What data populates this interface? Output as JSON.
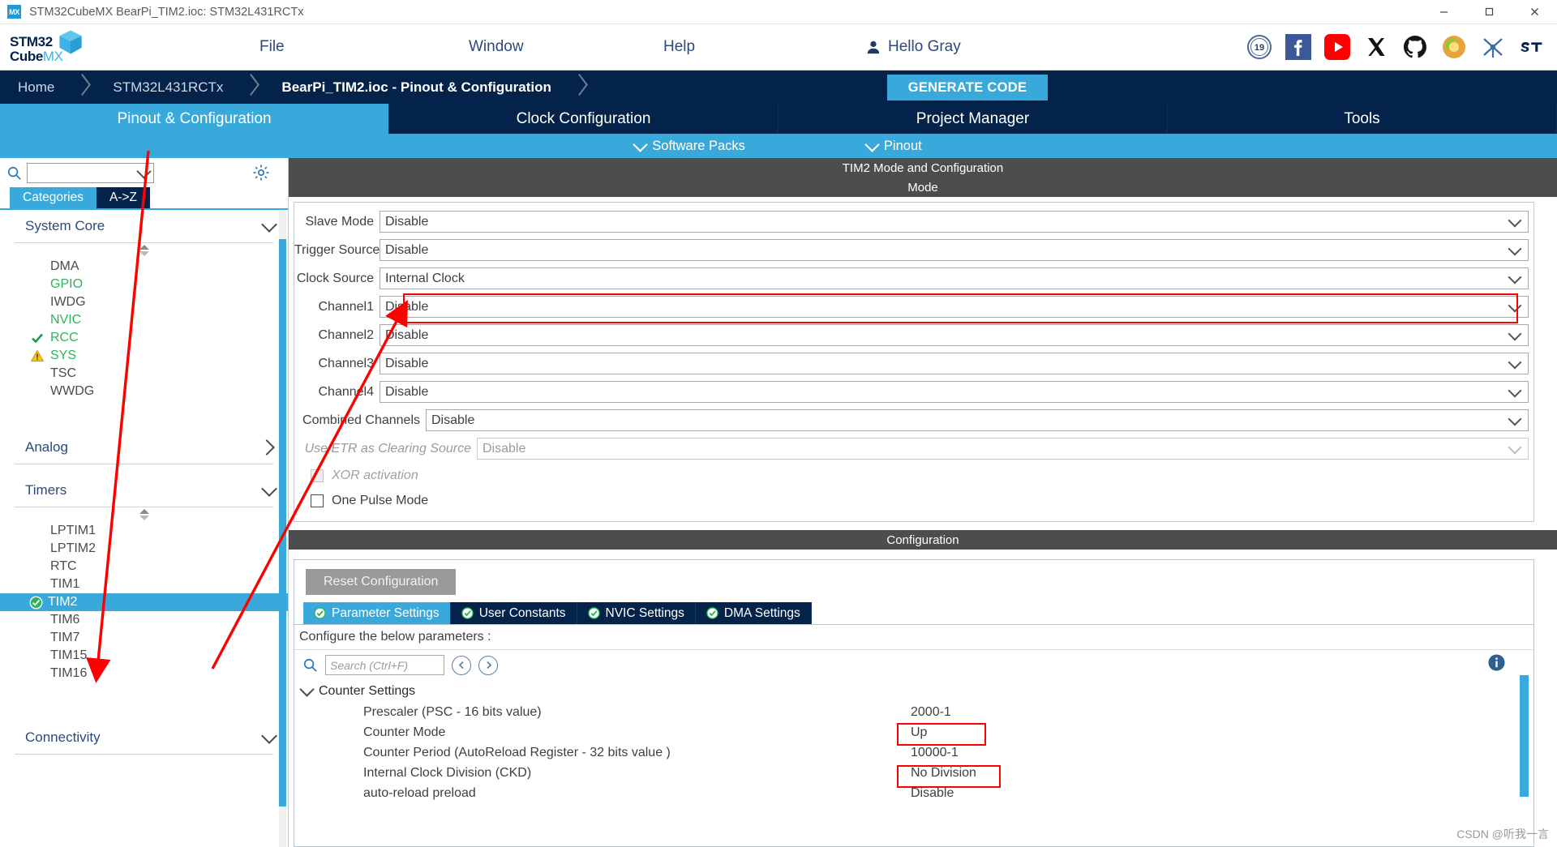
{
  "window": {
    "title": "STM32CubeMX BearPi_TIM2.ioc: STM32L431RCTx",
    "app_icon": "cubemx-icon",
    "minimize": "–",
    "maximize": "❐",
    "close": "✕"
  },
  "brand": {
    "line1_bold": "STM32",
    "line1_thin": "",
    "line2_bold": "Cube",
    "line2_thin": "MX"
  },
  "menu": {
    "file": "File",
    "window": "Window",
    "help": "Help",
    "user": "Hello Gray"
  },
  "socials": [
    {
      "name": "anniversary-badge-icon",
      "label": "19"
    },
    {
      "name": "facebook-icon",
      "label": "f"
    },
    {
      "name": "youtube-icon",
      "label": "▶"
    },
    {
      "name": "x-twitter-icon",
      "label": "𝕏"
    },
    {
      "name": "github-icon",
      "label": ""
    },
    {
      "name": "community-icon",
      "label": ""
    },
    {
      "name": "network-icon",
      "label": ""
    },
    {
      "name": "st-logo-icon",
      "label": "ST"
    }
  ],
  "breadcrumb": {
    "items": [
      {
        "label": "Home",
        "active": false
      },
      {
        "label": "STM32L431RCTx",
        "active": false
      },
      {
        "label": "BearPi_TIM2.ioc - Pinout & Configuration",
        "active": true
      }
    ],
    "generate_code": "GENERATE CODE"
  },
  "main_tabs": [
    {
      "label": "Pinout & Configuration",
      "selected": true
    },
    {
      "label": "Clock Configuration",
      "selected": false
    },
    {
      "label": "Project Manager",
      "selected": false
    },
    {
      "label": "Tools",
      "selected": false
    }
  ],
  "sub_tabs": [
    {
      "label": "Software Packs",
      "icon": "chevron-down-icon"
    },
    {
      "label": "Pinout",
      "icon": "chevron-down-icon"
    }
  ],
  "left_panel": {
    "search_placeholder": "",
    "search_value": "",
    "gear_icon": "gear-icon",
    "category_tabs": [
      {
        "label": "Categories",
        "selected": true
      },
      {
        "label": "A->Z",
        "selected": false
      }
    ],
    "groups": [
      {
        "name": "System Core",
        "expanded": true,
        "items": [
          {
            "label": "DMA",
            "state": "none",
            "selected": false
          },
          {
            "label": "GPIO",
            "state": "green",
            "selected": false
          },
          {
            "label": "IWDG",
            "state": "none",
            "selected": false
          },
          {
            "label": "NVIC",
            "state": "green",
            "selected": false
          },
          {
            "label": "RCC",
            "state": "check",
            "selected": false
          },
          {
            "label": "SYS",
            "state": "warn",
            "selected": false
          },
          {
            "label": "TSC",
            "state": "none",
            "selected": false
          },
          {
            "label": "WWDG",
            "state": "none",
            "selected": false
          }
        ]
      },
      {
        "name": "Analog",
        "expanded": false,
        "items": []
      },
      {
        "name": "Timers",
        "expanded": true,
        "items": [
          {
            "label": "LPTIM1",
            "state": "none",
            "selected": false
          },
          {
            "label": "LPTIM2",
            "state": "none",
            "selected": false
          },
          {
            "label": "RTC",
            "state": "none",
            "selected": false
          },
          {
            "label": "TIM1",
            "state": "none",
            "selected": false
          },
          {
            "label": "TIM2",
            "state": "ok",
            "selected": true
          },
          {
            "label": "TIM6",
            "state": "none",
            "selected": false
          },
          {
            "label": "TIM7",
            "state": "none",
            "selected": false
          },
          {
            "label": "TIM15",
            "state": "none",
            "selected": false
          },
          {
            "label": "TIM16",
            "state": "none",
            "selected": false
          }
        ]
      },
      {
        "name": "Connectivity",
        "expanded": false,
        "items": []
      }
    ]
  },
  "right_panel": {
    "header": "TIM2 Mode and Configuration",
    "mode_band": "Mode",
    "mode_rows": [
      {
        "label": "Slave Mode",
        "value": "Disable",
        "disabled": false,
        "highlight": false
      },
      {
        "label": "Trigger Source",
        "value": "Disable",
        "disabled": false,
        "highlight": false
      },
      {
        "label": "Clock Source",
        "value": "Internal Clock",
        "disabled": false,
        "highlight": true
      },
      {
        "label": "Channel1",
        "value": "Disable",
        "disabled": false,
        "highlight": false
      },
      {
        "label": "Channel2",
        "value": "Disable",
        "disabled": false,
        "highlight": false
      },
      {
        "label": "Channel3",
        "value": "Disable",
        "disabled": false,
        "highlight": false
      },
      {
        "label": "Channel4",
        "value": "Disable",
        "disabled": false,
        "highlight": false
      },
      {
        "label": "Combined Channels",
        "value": "Disable",
        "disabled": false,
        "highlight": false
      },
      {
        "label": "Use ETR as Clearing Source",
        "value": "Disable",
        "disabled": true,
        "highlight": false
      }
    ],
    "checkboxes": [
      {
        "label": "XOR activation",
        "checked": false,
        "disabled": true
      },
      {
        "label": "One Pulse Mode",
        "checked": false,
        "disabled": false
      }
    ],
    "config_band": "Configuration",
    "reset_button": "Reset Configuration",
    "config_tabs": [
      {
        "label": "Parameter Settings",
        "selected": true
      },
      {
        "label": "User Constants",
        "selected": false
      },
      {
        "label": "NVIC Settings",
        "selected": false
      },
      {
        "label": "DMA Settings",
        "selected": false
      }
    ],
    "configure_hint": "Configure the below parameters :",
    "param_search_placeholder": "Search (Ctrl+F)",
    "param_search_value": "",
    "sections": [
      {
        "name": "Counter Settings",
        "expanded": true,
        "params": [
          {
            "name": "Prescaler (PSC - 16 bits value)",
            "value": "2000-1",
            "highlight": true
          },
          {
            "name": "Counter Mode",
            "value": "Up",
            "highlight": false
          },
          {
            "name": "Counter Period (AutoReload Register - 32 bits value )",
            "value": "10000-1",
            "highlight": true
          },
          {
            "name": "Internal Clock Division (CKD)",
            "value": "No Division",
            "highlight": false
          },
          {
            "name": "auto-reload preload",
            "value": "Disable",
            "highlight": false
          }
        ]
      }
    ]
  },
  "watermark": "CSDN @听我一言",
  "colors": {
    "accent_blue": "#39a9dc",
    "dark_navy": "#03234b",
    "band_gray": "#4d4d4d",
    "annotation_red": "#ff0000",
    "green": "#2fb35b",
    "warn_yellow": "#f5c518"
  }
}
